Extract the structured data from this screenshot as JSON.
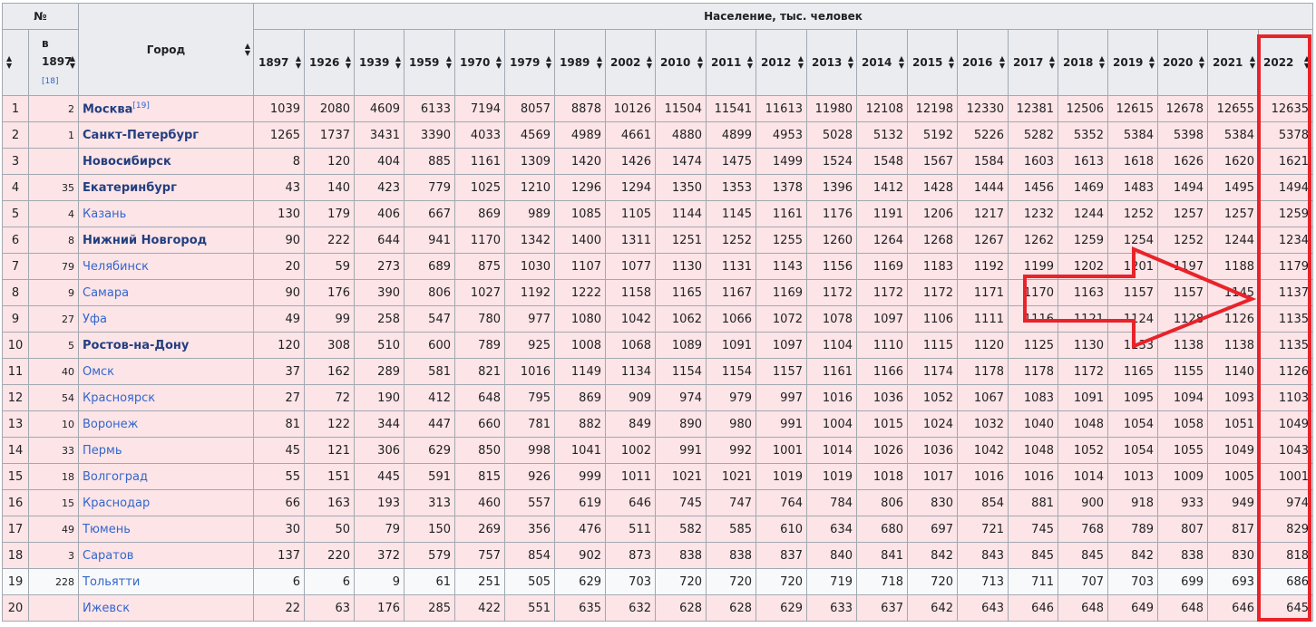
{
  "header": {
    "no_label": "№",
    "city_label": "Город",
    "in1897_label": "в\n1897",
    "in1897_line1": "в",
    "in1897_line2": "1897",
    "ref18": "[18]",
    "population_label": "Население, тыс. человек",
    "years": [
      "1897",
      "1926",
      "1939",
      "1959",
      "1970",
      "1979",
      "1989",
      "2002",
      "2010",
      "2011",
      "2012",
      "2013",
      "2014",
      "2015",
      "2016",
      "2017",
      "2018",
      "2019",
      "2020",
      "2021",
      "2022"
    ]
  },
  "rows": [
    {
      "n": "1",
      "r1897": "2",
      "city": "Москва",
      "sup": "[19]",
      "bold": true,
      "vals": [
        "1039",
        "2080",
        "4609",
        "6133",
        "7194",
        "8057",
        "8878",
        "10126",
        "11504",
        "11541",
        "11613",
        "11980",
        "12108",
        "12198",
        "12330",
        "12381",
        "12506",
        "12615",
        "12678",
        "12655",
        "12635"
      ]
    },
    {
      "n": "2",
      "r1897": "1",
      "city": "Санкт-Петербург",
      "bold": true,
      "vals": [
        "1265",
        "1737",
        "3431",
        "3390",
        "4033",
        "4569",
        "4989",
        "4661",
        "4880",
        "4899",
        "4953",
        "5028",
        "5132",
        "5192",
        "5226",
        "5282",
        "5352",
        "5384",
        "5398",
        "5384",
        "5378"
      ]
    },
    {
      "n": "3",
      "r1897": "",
      "city": "Новосибирск",
      "bold": true,
      "vals": [
        "8",
        "120",
        "404",
        "885",
        "1161",
        "1309",
        "1420",
        "1426",
        "1474",
        "1475",
        "1499",
        "1524",
        "1548",
        "1567",
        "1584",
        "1603",
        "1613",
        "1618",
        "1626",
        "1620",
        "1621"
      ]
    },
    {
      "n": "4",
      "r1897": "35",
      "city": "Екатеринбург",
      "bold": true,
      "vals": [
        "43",
        "140",
        "423",
        "779",
        "1025",
        "1210",
        "1296",
        "1294",
        "1350",
        "1353",
        "1378",
        "1396",
        "1412",
        "1428",
        "1444",
        "1456",
        "1469",
        "1483",
        "1494",
        "1495",
        "1494"
      ]
    },
    {
      "n": "5",
      "r1897": "4",
      "city": "Казань",
      "bold": false,
      "vals": [
        "130",
        "179",
        "406",
        "667",
        "869",
        "989",
        "1085",
        "1105",
        "1144",
        "1145",
        "1161",
        "1176",
        "1191",
        "1206",
        "1217",
        "1232",
        "1244",
        "1252",
        "1257",
        "1257",
        "1259"
      ]
    },
    {
      "n": "6",
      "r1897": "8",
      "city": "Нижний Новгород",
      "bold": true,
      "vals": [
        "90",
        "222",
        "644",
        "941",
        "1170",
        "1342",
        "1400",
        "1311",
        "1251",
        "1252",
        "1255",
        "1260",
        "1264",
        "1268",
        "1267",
        "1262",
        "1259",
        "1254",
        "1252",
        "1244",
        "1234"
      ]
    },
    {
      "n": "7",
      "r1897": "79",
      "city": "Челябинск",
      "bold": false,
      "vals": [
        "20",
        "59",
        "273",
        "689",
        "875",
        "1030",
        "1107",
        "1077",
        "1130",
        "1131",
        "1143",
        "1156",
        "1169",
        "1183",
        "1192",
        "1199",
        "1202",
        "1201",
        "1197",
        "1188",
        "1179"
      ]
    },
    {
      "n": "8",
      "r1897": "9",
      "city": "Самара",
      "bold": false,
      "vals": [
        "90",
        "176",
        "390",
        "806",
        "1027",
        "1192",
        "1222",
        "1158",
        "1165",
        "1167",
        "1169",
        "1172",
        "1172",
        "1172",
        "1171",
        "1170",
        "1163",
        "1157",
        "1157",
        "1145",
        "1137"
      ]
    },
    {
      "n": "9",
      "r1897": "27",
      "city": "Уфа",
      "bold": false,
      "vals": [
        "49",
        "99",
        "258",
        "547",
        "780",
        "977",
        "1080",
        "1042",
        "1062",
        "1066",
        "1072",
        "1078",
        "1097",
        "1106",
        "1111",
        "1116",
        "1121",
        "1124",
        "1128",
        "1126",
        "1135"
      ]
    },
    {
      "n": "10",
      "r1897": "5",
      "city": "Ростов-на-Дону",
      "bold": true,
      "vals": [
        "120",
        "308",
        "510",
        "600",
        "789",
        "925",
        "1008",
        "1068",
        "1089",
        "1091",
        "1097",
        "1104",
        "1110",
        "1115",
        "1120",
        "1125",
        "1130",
        "1133",
        "1138",
        "1138",
        "1135"
      ]
    },
    {
      "n": "11",
      "r1897": "40",
      "city": "Омск",
      "bold": false,
      "vals": [
        "37",
        "162",
        "289",
        "581",
        "821",
        "1016",
        "1149",
        "1134",
        "1154",
        "1154",
        "1157",
        "1161",
        "1166",
        "1174",
        "1178",
        "1178",
        "1172",
        "1165",
        "1155",
        "1140",
        "1126"
      ]
    },
    {
      "n": "12",
      "r1897": "54",
      "city": "Красноярск",
      "bold": false,
      "vals": [
        "27",
        "72",
        "190",
        "412",
        "648",
        "795",
        "869",
        "909",
        "974",
        "979",
        "997",
        "1016",
        "1036",
        "1052",
        "1067",
        "1083",
        "1091",
        "1095",
        "1094",
        "1093",
        "1103"
      ]
    },
    {
      "n": "13",
      "r1897": "10",
      "city": "Воронеж",
      "bold": false,
      "vals": [
        "81",
        "122",
        "344",
        "447",
        "660",
        "781",
        "882",
        "849",
        "890",
        "980",
        "991",
        "1004",
        "1015",
        "1024",
        "1032",
        "1040",
        "1048",
        "1054",
        "1058",
        "1051",
        "1049"
      ]
    },
    {
      "n": "14",
      "r1897": "33",
      "city": "Пермь",
      "bold": false,
      "vals": [
        "45",
        "121",
        "306",
        "629",
        "850",
        "998",
        "1041",
        "1002",
        "991",
        "992",
        "1001",
        "1014",
        "1026",
        "1036",
        "1042",
        "1048",
        "1052",
        "1054",
        "1055",
        "1049",
        "1043"
      ]
    },
    {
      "n": "15",
      "r1897": "18",
      "city": "Волгоград",
      "bold": false,
      "vals": [
        "55",
        "151",
        "445",
        "591",
        "815",
        "926",
        "999",
        "1011",
        "1021",
        "1021",
        "1019",
        "1019",
        "1018",
        "1017",
        "1016",
        "1016",
        "1014",
        "1013",
        "1009",
        "1005",
        "1001"
      ]
    },
    {
      "n": "16",
      "r1897": "15",
      "city": "Краснодар",
      "bold": false,
      "vals": [
        "66",
        "163",
        "193",
        "313",
        "460",
        "557",
        "619",
        "646",
        "745",
        "747",
        "764",
        "784",
        "806",
        "830",
        "854",
        "881",
        "900",
        "918",
        "933",
        "949",
        "974"
      ]
    },
    {
      "n": "17",
      "r1897": "49",
      "city": "Тюмень",
      "bold": false,
      "vals": [
        "30",
        "50",
        "79",
        "150",
        "269",
        "356",
        "476",
        "511",
        "582",
        "585",
        "610",
        "634",
        "680",
        "697",
        "721",
        "745",
        "768",
        "789",
        "807",
        "817",
        "829"
      ]
    },
    {
      "n": "18",
      "r1897": "3",
      "city": "Саратов",
      "bold": false,
      "vals": [
        "137",
        "220",
        "372",
        "579",
        "757",
        "854",
        "902",
        "873",
        "838",
        "838",
        "837",
        "840",
        "841",
        "842",
        "843",
        "845",
        "845",
        "842",
        "838",
        "830",
        "818"
      ]
    },
    {
      "n": "19",
      "r1897": "228",
      "city": "Тольятти",
      "bold": false,
      "white": true,
      "vals": [
        "6",
        "6",
        "9",
        "61",
        "251",
        "505",
        "629",
        "703",
        "720",
        "720",
        "720",
        "719",
        "718",
        "720",
        "713",
        "711",
        "707",
        "703",
        "699",
        "693",
        "686"
      ]
    },
    {
      "n": "20",
      "r1897": "",
      "city": "Ижевск",
      "bold": false,
      "vals": [
        "22",
        "63",
        "176",
        "285",
        "422",
        "551",
        "635",
        "632",
        "628",
        "628",
        "629",
        "633",
        "637",
        "642",
        "643",
        "646",
        "648",
        "649",
        "648",
        "646",
        "645"
      ]
    }
  ],
  "colors": {
    "highlight": "#e8232a",
    "row_pink": "#fce4e7",
    "header_bg": "#eaecf0",
    "link": "#3366cc"
  },
  "icons": {
    "sort": "sort-arrows-icon",
    "arrow": "red-arrow-icon"
  }
}
